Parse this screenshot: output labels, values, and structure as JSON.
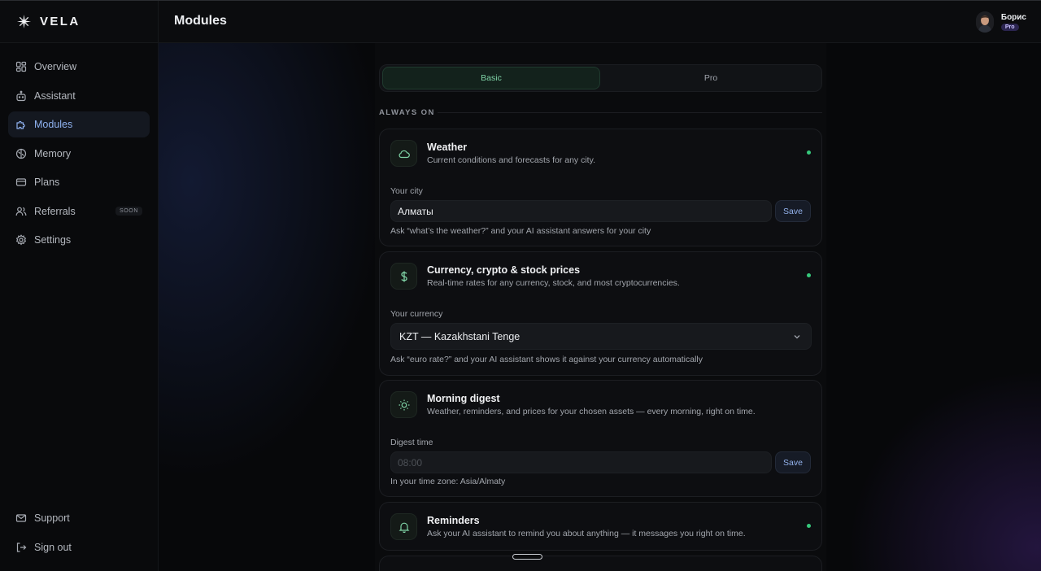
{
  "app": {
    "brand": "VELA",
    "page_title": "Modules"
  },
  "user": {
    "name": "Борис",
    "plan": "Pro"
  },
  "sidebar": {
    "items": [
      {
        "label": "Overview",
        "icon": "grid-icon",
        "active": false
      },
      {
        "label": "Assistant",
        "icon": "bot-icon",
        "active": false
      },
      {
        "label": "Modules",
        "icon": "puzzle-icon",
        "active": true
      },
      {
        "label": "Memory",
        "icon": "brain-icon",
        "active": false
      },
      {
        "label": "Plans",
        "icon": "credit-card-icon",
        "active": false
      },
      {
        "label": "Referrals",
        "icon": "users-icon",
        "active": false,
        "badge": "SOON"
      },
      {
        "label": "Settings",
        "icon": "gear-icon",
        "active": false
      }
    ],
    "bottom": [
      {
        "label": "Support",
        "icon": "mail-icon"
      },
      {
        "label": "Sign out",
        "icon": "sign-out-icon"
      }
    ]
  },
  "tabs": [
    {
      "label": "Basic",
      "active": true
    },
    {
      "label": "Pro",
      "active": false
    }
  ],
  "section": {
    "label": "ALWAYS ON"
  },
  "modules": {
    "weather": {
      "title": "Weather",
      "description": "Current conditions and forecasts for any city.",
      "icon": "cloud-icon",
      "status": "on",
      "field_label": "Your city",
      "value": "Алматы",
      "button": "Save",
      "hint": "Ask “what’s the weather?” and your AI assistant answers for your city"
    },
    "currency": {
      "title": "Currency, crypto & stock prices",
      "description": "Real-time rates for any currency, stock, and most cryptocurrencies.",
      "icon": "dollar-icon",
      "status": "on",
      "field_label": "Your currency",
      "selected": "KZT — Kazakhstani Tenge",
      "hint": "Ask “euro rate?” and your AI assistant shows it against your currency automatically"
    },
    "digest": {
      "title": "Morning digest",
      "description": "Weather, reminders, and prices for your chosen assets — every morning, right on time.",
      "icon": "sun-icon",
      "field_label": "Digest time",
      "placeholder": "08:00",
      "button": "Save",
      "hint": "In your time zone: Asia/Almaty"
    },
    "reminders": {
      "title": "Reminders",
      "description": "Ask your AI assistant to remind you about anything — it messages you right on time.",
      "icon": "bell-icon",
      "status": "on"
    }
  },
  "colors": {
    "accent_green": "#36c97c",
    "accent_blue": "#8fb2f0",
    "background": "#07080a"
  }
}
